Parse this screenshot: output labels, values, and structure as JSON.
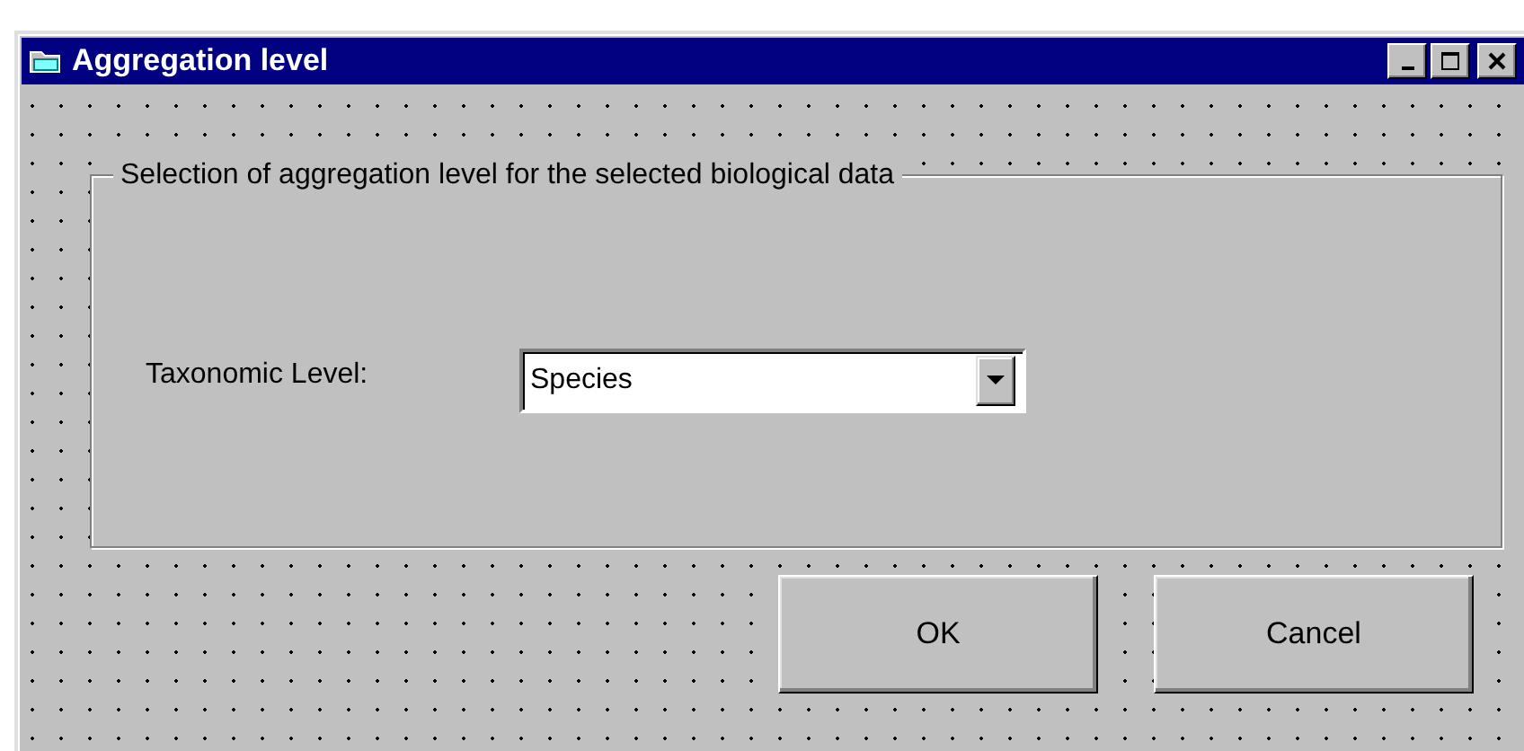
{
  "window": {
    "title": "Aggregation level"
  },
  "frame": {
    "caption": "Selection of aggregation level for the selected biological data"
  },
  "taxonomic_level": {
    "label": "Taxonomic Level:",
    "value": "Species"
  },
  "buttons": [
    {
      "label": "OK"
    },
    {
      "label": "Cancel"
    }
  ]
}
